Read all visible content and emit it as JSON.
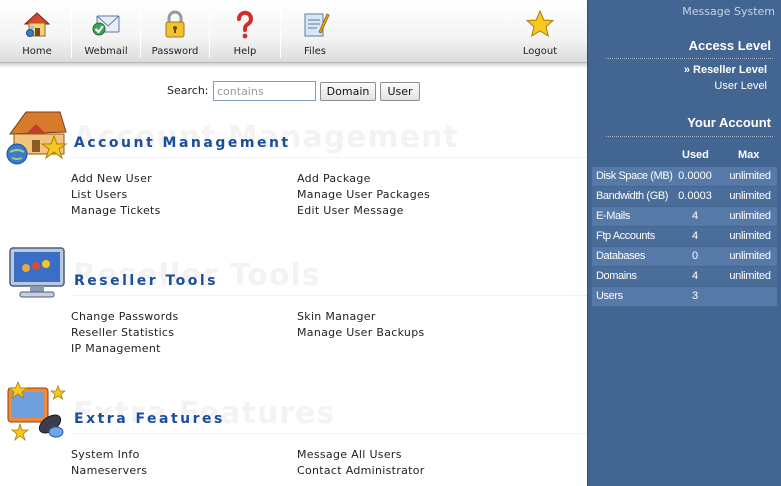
{
  "toolbar": {
    "home_label": "Home",
    "webmail_label": "Webmail",
    "password_label": "Password",
    "help_label": "Help",
    "files_label": "Files",
    "logout_label": "Logout"
  },
  "search": {
    "label": "Search:",
    "placeholder": "contains",
    "domain_button": "Domain",
    "user_button": "User"
  },
  "sections": {
    "account": {
      "title": "Account Management",
      "links": [
        "Add New User",
        "List Users",
        "Manage Tickets",
        "Add Package",
        "Manage User Packages",
        "Edit User Message"
      ]
    },
    "reseller": {
      "title": "Reseller Tools",
      "links": [
        "Change Passwords",
        "Reseller Statistics",
        "IP Management",
        "Skin Manager",
        "Manage User Backups"
      ]
    },
    "extra": {
      "title": "Extra Features",
      "links": [
        "System Info",
        "Nameservers",
        "Message All Users",
        "Contact Administrator"
      ]
    }
  },
  "right_panel": {
    "header": "Message System",
    "access_title": "Access Level",
    "access_items": [
      "» Reseller Level",
      "User Level"
    ],
    "account_title": "Your Account",
    "usage_headers": {
      "used": "Used",
      "max": "Max"
    },
    "usage": [
      {
        "label": "Disk Space (MB)",
        "used": "0.0000",
        "max": "unlimited"
      },
      {
        "label": "Bandwidth (GB)",
        "used": "0.0003",
        "max": "unlimited"
      },
      {
        "label": "E-Mails",
        "used": "4",
        "max": "unlimited"
      },
      {
        "label": "Ftp Accounts",
        "used": "4",
        "max": "unlimited"
      },
      {
        "label": "Databases",
        "used": "0",
        "max": "unlimited"
      },
      {
        "label": "Domains",
        "used": "4",
        "max": "unlimited"
      },
      {
        "label": "Users",
        "used": "3",
        "max": ""
      }
    ]
  },
  "colors": {
    "section_title": "#1a4f9c",
    "panel_bg": "#426592",
    "row_light": "#5679a7",
    "row_dark": "#4a6d9a"
  },
  "icons": {
    "home": "house-icon",
    "webmail": "envelope-icon",
    "password": "padlock-icon",
    "help": "question-mark-icon",
    "files": "clipboard-icon",
    "logout": "star-icon"
  }
}
